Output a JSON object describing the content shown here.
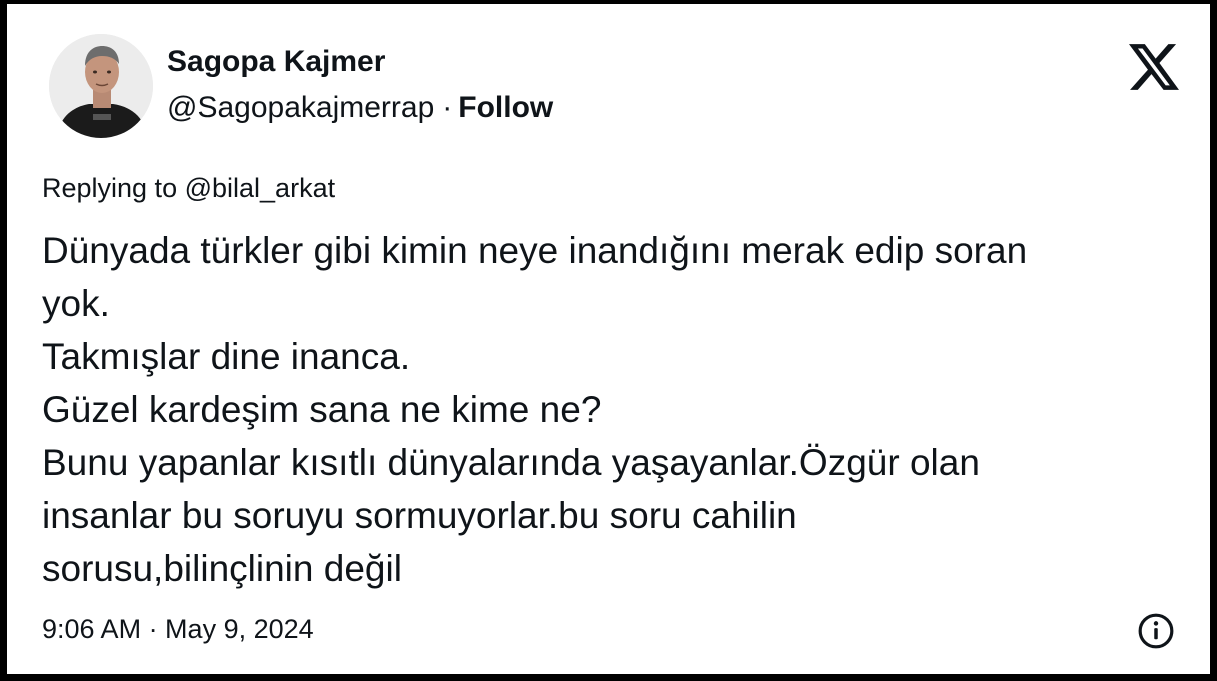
{
  "author": {
    "name": "Sagopa Kajmer",
    "handle": "@Sagopakajmerrap",
    "separator": "·",
    "follow_label": "Follow"
  },
  "header": {
    "logo_icon": "x-logo-icon"
  },
  "reply": {
    "prefix": "Replying to",
    "mention": "@bilal_arkat"
  },
  "tweet": {
    "lines": [
      "Dünyada türkler gibi kimin neye inandığını merak edip soran",
      "yok.",
      "Takmışlar dine inanca.",
      "Güzel kardeşim sana ne kime ne?",
      "Bunu yapanlar kısıtlı dünyalarında yaşayanlar.Özgür olan",
      "insanlar bu soruyu sormuyorlar.bu soru cahilin",
      "sorusu,bilinçlinin değil"
    ]
  },
  "footer": {
    "timestamp": "9:06 AM · May 9, 2024",
    "info_icon": "info-icon"
  },
  "colors": {
    "text": "#0f1419",
    "background": "#ffffff",
    "frame": "#000000"
  }
}
